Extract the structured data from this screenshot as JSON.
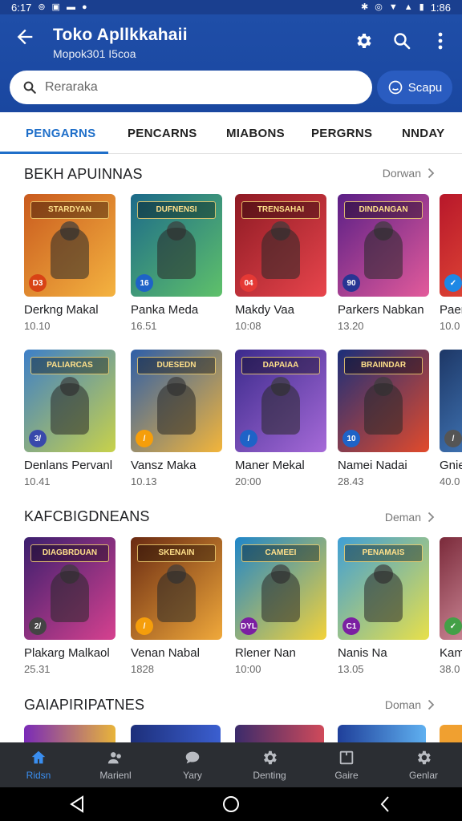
{
  "status_bar": {
    "time": "6:17",
    "battery": "1:86"
  },
  "app_bar": {
    "title": "Toko Apllkkahaii",
    "subtitle": "Mopok301 I5coa",
    "search_placeholder": "Reraraka",
    "scan_label": "Scapu"
  },
  "tabs": [
    {
      "label": "PENGARNS",
      "active": true
    },
    {
      "label": "PENCARNS",
      "active": false
    },
    {
      "label": "MIABONS",
      "active": false
    },
    {
      "label": "PERGRNS",
      "active": false
    },
    {
      "label": "NNDAY",
      "active": false
    }
  ],
  "sections": [
    {
      "title": "BEKH APUINNAS",
      "more": "Dorwan",
      "items": [
        {
          "name": "Derkng Makal",
          "meta": "10.10",
          "banner": "STARDYAN",
          "badge": "D3",
          "bg1": "#c95a1e",
          "bg2": "#f4b340",
          "badge_color": "#d84315"
        },
        {
          "name": "Panka Meda",
          "meta": "16.51",
          "banner": "DUFNENSI",
          "badge": "16",
          "bg1": "#1c6a8a",
          "bg2": "#5fc16a",
          "badge_color": "#1e63c7"
        },
        {
          "name": "Makdy Vaa",
          "meta": "10:08",
          "banner": "TRENSAHAI",
          "badge": "04",
          "bg1": "#8e1a24",
          "bg2": "#e8454c",
          "badge_color": "#e53935"
        },
        {
          "name": "Parkers Nabkan",
          "meta": "13.20",
          "banner": "DINDANGAN",
          "badge": "90",
          "bg1": "#5a1f86",
          "bg2": "#e35b9b",
          "badge_color": "#283593"
        },
        {
          "name": "Paer",
          "meta": "10.0",
          "banner": "",
          "badge": "✓",
          "bg1": "#b7172a",
          "bg2": "#f05a3a",
          "badge_color": "#1e88e5"
        }
      ]
    },
    {
      "title": "",
      "more": "",
      "items": [
        {
          "name": "Denlans Pervanl",
          "meta": "10.41",
          "banner": "PALIARCAS",
          "badge": "3/",
          "bg1": "#3d7fc8",
          "bg2": "#c8d24a",
          "badge_color": "#3949ab"
        },
        {
          "name": "Vansz Maka",
          "meta": "10.13",
          "banner": "DUESEDN",
          "badge": "/",
          "bg1": "#2d5ea8",
          "bg2": "#f3b53a",
          "badge_color": "#f59e0b"
        },
        {
          "name": "Maner Mekal",
          "meta": "20:00",
          "banner": "DAPAIAA",
          "badge": "/",
          "bg1": "#3b2a8c",
          "bg2": "#a66ad8",
          "badge_color": "#1e63c7"
        },
        {
          "name": "Namei Nadai",
          "meta": "28.43",
          "banner": "BRAIINDAR",
          "badge": "10",
          "bg1": "#1b2f7a",
          "bg2": "#e24a2b",
          "badge_color": "#1e63c7"
        },
        {
          "name": "Gnie",
          "meta": "40.0",
          "banner": "",
          "badge": "/",
          "bg1": "#1d3766",
          "bg2": "#4f8fd6",
          "badge_color": "#555555"
        }
      ]
    },
    {
      "title": "KAFCBIGDNEANS",
      "more": "Deman",
      "items": [
        {
          "name": "Plakarg Malkaol",
          "meta": "25.31",
          "banner": "DIAGBRDUAN",
          "badge": "2/",
          "bg1": "#3b1f6e",
          "bg2": "#d6418f",
          "badge_color": "#444444"
        },
        {
          "name": "Venan Nabal",
          "meta": "1828",
          "banner": "SKENAIN",
          "badge": "/",
          "bg1": "#6a2a12",
          "bg2": "#f0a93b",
          "badge_color": "#f59e0b"
        },
        {
          "name": "Rlener Nan",
          "meta": "10:00",
          "banner": "CAMEEI",
          "badge": "DYL",
          "bg1": "#1f86c9",
          "bg2": "#f3d23a",
          "badge_color": "#7b1fa2"
        },
        {
          "name": "Nanis Na",
          "meta": "13.05",
          "banner": "PENAMAIS",
          "badge": "C1",
          "bg1": "#3f9fd6",
          "bg2": "#e8e04a",
          "badge_color": "#7b1fa2"
        },
        {
          "name": "Kam",
          "meta": "38.0",
          "banner": "",
          "badge": "✓",
          "bg1": "#7a2a3a",
          "bg2": "#f2b3c2",
          "badge_color": "#43a047"
        }
      ]
    },
    {
      "title": "GAIAPIRIPATNES",
      "more": "Doman",
      "items": []
    }
  ],
  "bottom_nav": [
    {
      "label": "Ridsn",
      "icon": "home-icon",
      "active": true
    },
    {
      "label": "Marienl",
      "icon": "people-icon",
      "active": false
    },
    {
      "label": "Yary",
      "icon": "chat-icon",
      "active": false
    },
    {
      "label": "Denting",
      "icon": "gear-icon",
      "active": false
    },
    {
      "label": "Gaire",
      "icon": "box-icon",
      "active": false
    },
    {
      "label": "Genlar",
      "icon": "settings-icon",
      "active": false
    }
  ],
  "colors": {
    "primary": "#1f4ea8",
    "accent": "#1f6fc9",
    "nav_active": "#3a8ef0"
  }
}
